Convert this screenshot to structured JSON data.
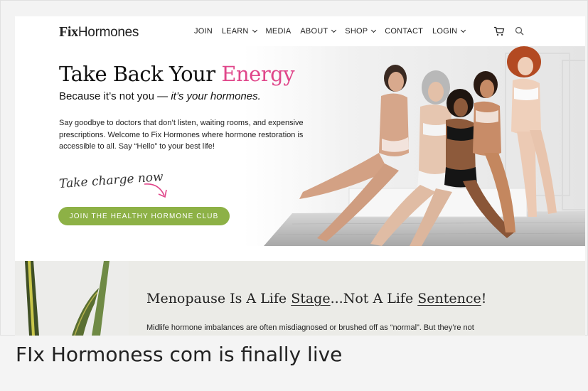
{
  "brand": {
    "logo_part1": "Fix",
    "logo_part2": "Hormones"
  },
  "nav": {
    "items": [
      {
        "label": "JOIN",
        "dropdown": false
      },
      {
        "label": "LEARN",
        "dropdown": true
      },
      {
        "label": "MEDIA",
        "dropdown": false
      },
      {
        "label": "ABOUT",
        "dropdown": true
      },
      {
        "label": "SHOP",
        "dropdown": true
      },
      {
        "label": "CONTACT",
        "dropdown": false
      },
      {
        "label": "LOGIN",
        "dropdown": true
      }
    ],
    "cart_icon": "cart-icon",
    "search_icon": "search-icon"
  },
  "hero": {
    "title_main": "Take Back Your ",
    "title_accent": "Energy",
    "subtitle_main": "Because it’s not you — ",
    "subtitle_italic": "it’s your hormones.",
    "body": "Say goodbye to doctors that don’t listen, waiting rooms, and expensive prescriptions. Welcome to Fix Hormones where hormone restoration is accessible to all. Say “Hello” to your best life!",
    "handwritten": "Take charge now",
    "cta": "JOIN THE HEALTHY HORMONE CLUB"
  },
  "section2": {
    "title_part1": "Menopause Is A Life ",
    "title_u1": "Stage",
    "title_part2": "...Not A Life ",
    "title_u2": "Sentence",
    "title_part3": "!",
    "body_line1": "Midlife hormone imbalances are often misdiagnosed or brushed off as “normal”. But they’re not"
  },
  "caption": "FIx Hormoness com is finally live",
  "colors": {
    "accent_pink": "#e0468a",
    "cta_green": "#8db146"
  }
}
